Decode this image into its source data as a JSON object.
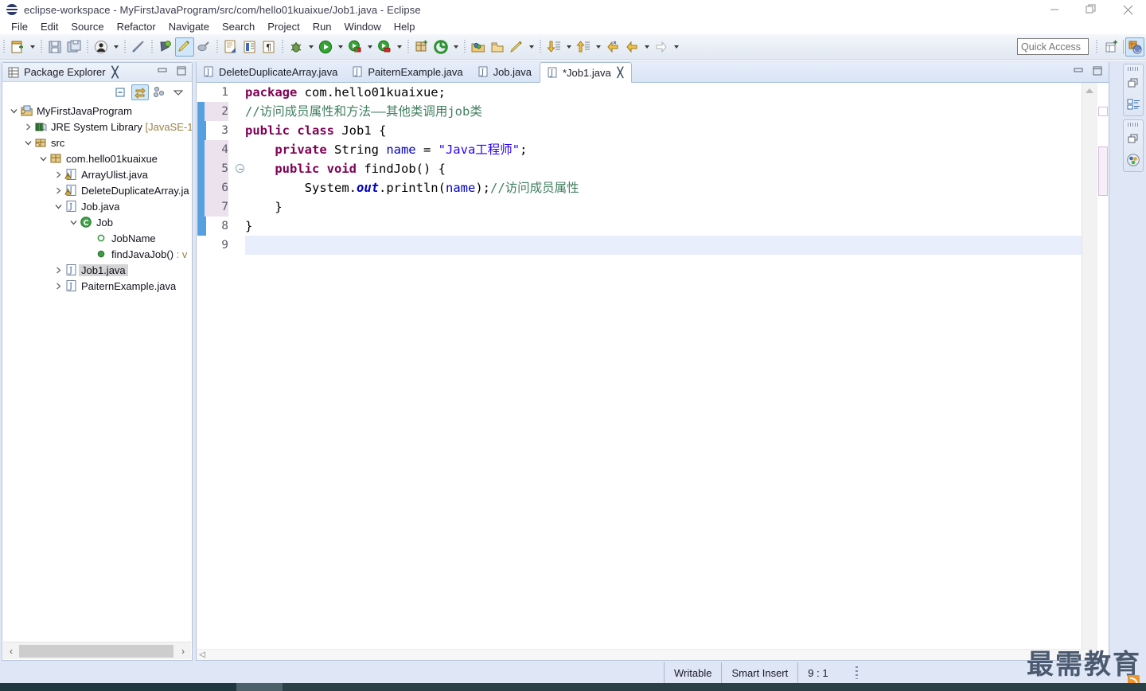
{
  "window": {
    "title": "eclipse-workspace - MyFirstJavaProgram/src/com/hello01kuaixue/Job1.java - Eclipse",
    "icon": "eclipse-globe-icon",
    "minimize": "—",
    "maximize": "❐",
    "close": "✕"
  },
  "menubar": {
    "items": [
      {
        "label": "File"
      },
      {
        "label": "Edit"
      },
      {
        "label": "Source"
      },
      {
        "label": "Refactor"
      },
      {
        "label": "Navigate"
      },
      {
        "label": "Search"
      },
      {
        "label": "Project"
      },
      {
        "label": "Run"
      },
      {
        "label": "Window"
      },
      {
        "label": "Help"
      }
    ]
  },
  "toolbar": {
    "quick_access_placeholder": "Quick Access",
    "buttons": [
      {
        "name": "new-wizard-icon",
        "title": "New"
      },
      {
        "name": "save-icon",
        "title": "Save"
      },
      {
        "name": "save-all-icon",
        "title": "Save All"
      },
      {
        "name": "person-icon",
        "title": "Open Task"
      },
      {
        "name": "link-break-icon",
        "title": "Focus on Active Task"
      },
      {
        "name": "pin-refresh-icon",
        "title": "Pin"
      },
      {
        "name": "marker-highlight-icon",
        "title": "Toggle Mark Occurrences"
      },
      {
        "name": "pencil-gray-icon",
        "title": "Skip All Breakpoints"
      },
      {
        "name": "new-java-file-icon",
        "title": "New Java Class"
      },
      {
        "name": "list-panel-icon",
        "title": "Open Type"
      },
      {
        "name": "paragraph-icon",
        "title": "Show Whitespace"
      },
      {
        "name": "bug-debug-icon",
        "title": "Debug"
      },
      {
        "name": "run-green-icon",
        "title": "Run"
      },
      {
        "name": "run-external-tools-icon",
        "title": "External Tools"
      },
      {
        "name": "run-coverage-icon",
        "title": "Coverage"
      },
      {
        "name": "new-package-icon",
        "title": "New Package"
      },
      {
        "name": "open-type-green-icon",
        "title": "Open Type"
      },
      {
        "name": "open-folder-icon",
        "title": "Open Resource"
      },
      {
        "name": "open-box-icon",
        "title": "Open Task"
      },
      {
        "name": "pencil-gold-icon",
        "title": "Edit"
      },
      {
        "name": "next-annotation-icon",
        "title": "Next Annotation"
      },
      {
        "name": "previous-annotation-icon",
        "title": "Previous Annotation"
      },
      {
        "name": "back-history-icon",
        "title": "Back"
      },
      {
        "name": "back-arrow-icon",
        "title": "Back"
      },
      {
        "name": "forward-arrow-icon",
        "title": "Forward"
      }
    ],
    "right_buttons": [
      {
        "name": "new-perspective-icon",
        "title": "Open Perspective"
      },
      {
        "name": "java-perspective-icon",
        "title": "Java Perspective",
        "active": true
      }
    ]
  },
  "package_explorer": {
    "title": "Package Explorer",
    "close_glyph": "╳",
    "toolbar": [
      {
        "name": "collapse-all-icon",
        "active": false
      },
      {
        "name": "link-with-editor-icon",
        "active": true
      },
      {
        "name": "view-menu-hierarchy-icon",
        "active": false
      },
      {
        "name": "view-menu-icon",
        "active": false
      }
    ],
    "tree": [
      {
        "label": "MyFirstJavaProgram",
        "indent": 0,
        "twist": "down",
        "icon": "java-project-icon",
        "selected": false
      },
      {
        "label": "JRE System Library ",
        "suffix": "[JavaSE-1.",
        "indent": 1,
        "twist": "right",
        "icon": "library-icon",
        "selected": false
      },
      {
        "label": "src",
        "indent": 1,
        "twist": "down",
        "icon": "source-folder-icon",
        "selected": false
      },
      {
        "label": "com.hello01kuaixue",
        "indent": 2,
        "twist": "down",
        "icon": "package-icon",
        "selected": false
      },
      {
        "label": "ArrayUlist.java",
        "indent": 3,
        "twist": "right",
        "icon": "java-file-warning-icon",
        "selected": false
      },
      {
        "label": "DeleteDuplicateArray.ja",
        "indent": 3,
        "twist": "right",
        "icon": "java-file-warning-icon",
        "selected": false
      },
      {
        "label": "Job.java",
        "indent": 3,
        "twist": "down",
        "icon": "java-file-icon",
        "selected": false
      },
      {
        "label": "Job",
        "indent": 4,
        "twist": "down",
        "icon": "class-icon",
        "selected": false
      },
      {
        "label": "JobName",
        "indent": 5,
        "twist": "none",
        "icon": "field-package-icon",
        "selected": false
      },
      {
        "label": "findJavaJob() ",
        "suffix": ": v",
        "indent": 5,
        "twist": "none",
        "icon": "method-public-icon",
        "selected": false
      },
      {
        "label": "Job1.java",
        "indent": 3,
        "twist": "right",
        "icon": "java-file-icon",
        "selected": true
      },
      {
        "label": "PaiternExample.java",
        "indent": 3,
        "twist": "right",
        "icon": "java-file-icon",
        "selected": false
      }
    ],
    "hscroll": {
      "left_glyph": "‹",
      "right_glyph": "›"
    }
  },
  "editor": {
    "tabs": [
      {
        "label": "DeleteDuplicateArray.java",
        "active": false,
        "dirty": false,
        "icon": "java-file-icon"
      },
      {
        "label": "PaiternExample.java",
        "active": false,
        "dirty": false,
        "icon": "java-file-icon"
      },
      {
        "label": "Job.java",
        "active": false,
        "dirty": false,
        "icon": "java-file-icon"
      },
      {
        "label": "*Job1.java",
        "active": true,
        "dirty": true,
        "icon": "java-file-icon",
        "close_glyph": "╳"
      }
    ],
    "line_numbers": [
      "1",
      "2",
      "3",
      "4",
      "5",
      "6",
      "7",
      "8",
      "9"
    ],
    "highlighted_lines": [
      2,
      4,
      5,
      6,
      7
    ],
    "current_line": 9,
    "fold_marker_line": 5,
    "change_bar_lines": [
      2,
      3,
      4,
      5,
      6,
      7,
      8
    ],
    "code": [
      {
        "n": 1,
        "tokens": [
          {
            "t": "package",
            "c": "kw"
          },
          {
            "t": " com.hello01kuaixue;",
            "c": ""
          }
        ]
      },
      {
        "n": 2,
        "tokens": [
          {
            "t": "//访问成员属性和方法——其他类调用job类",
            "c": "cmt"
          }
        ]
      },
      {
        "n": 3,
        "tokens": [
          {
            "t": "public",
            "c": "kw"
          },
          {
            "t": " ",
            "c": ""
          },
          {
            "t": "class",
            "c": "kw"
          },
          {
            "t": " Job1 {",
            "c": ""
          }
        ]
      },
      {
        "n": 4,
        "tokens": [
          {
            "t": "    ",
            "c": ""
          },
          {
            "t": "private",
            "c": "kw"
          },
          {
            "t": " String ",
            "c": ""
          },
          {
            "t": "name",
            "c": "fld"
          },
          {
            "t": " = ",
            "c": ""
          },
          {
            "t": "\"Java工程师\"",
            "c": "str"
          },
          {
            "t": ";",
            "c": ""
          }
        ]
      },
      {
        "n": 5,
        "tokens": [
          {
            "t": "    ",
            "c": ""
          },
          {
            "t": "public",
            "c": "kw"
          },
          {
            "t": " ",
            "c": ""
          },
          {
            "t": "void",
            "c": "kw"
          },
          {
            "t": " findJob() {",
            "c": ""
          }
        ]
      },
      {
        "n": 6,
        "tokens": [
          {
            "t": "        System.",
            "c": ""
          },
          {
            "t": "out",
            "c": "stat"
          },
          {
            "t": ".println(",
            "c": ""
          },
          {
            "t": "name",
            "c": "fld"
          },
          {
            "t": ");",
            "c": ""
          },
          {
            "t": "//访问成员属性",
            "c": "cmt"
          }
        ]
      },
      {
        "n": 7,
        "tokens": [
          {
            "t": "    }",
            "c": ""
          }
        ]
      },
      {
        "n": 8,
        "tokens": [
          {
            "t": "}",
            "c": ""
          }
        ]
      },
      {
        "n": 9,
        "tokens": [
          {
            "t": "",
            "c": ""
          }
        ]
      }
    ]
  },
  "right_bar": {
    "groups": [
      {
        "buttons": [
          {
            "name": "restore-icon"
          },
          {
            "name": "outline-view-icon"
          }
        ]
      },
      {
        "buttons": [
          {
            "name": "restore-icon"
          },
          {
            "name": "task-list-icon"
          }
        ]
      }
    ]
  },
  "statusbar": {
    "writable": "Writable",
    "insert_mode": "Smart Insert",
    "position": "9 : 1"
  },
  "watermark": {
    "text": "最需教育",
    "badge": "rss-icon"
  },
  "colors": {
    "accent": "#cfe6fb",
    "chrome": "#dfe6f5",
    "keyword": "#7f0055",
    "comment": "#3f7f5f",
    "string": "#2a00ff",
    "field": "#0000c0",
    "selection": "#d4d4d4",
    "current_line": "#e8eefc",
    "taskbar": "#1f3840"
  }
}
